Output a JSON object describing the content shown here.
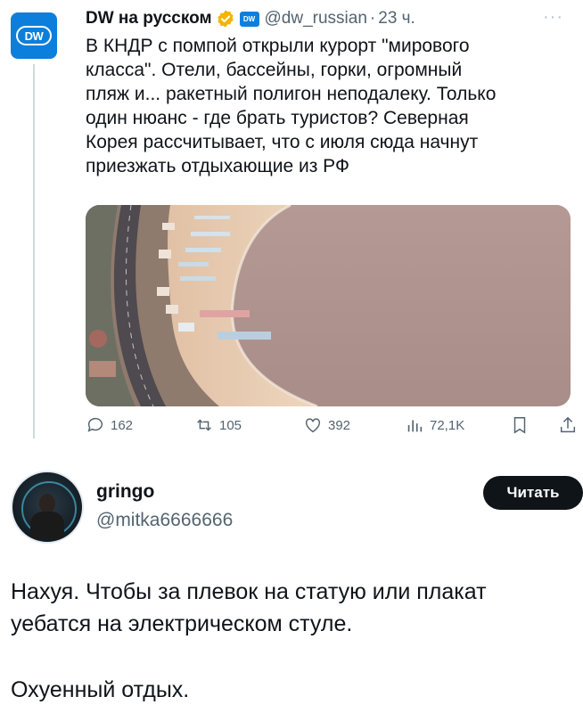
{
  "quoted_tweet": {
    "author_name": "DW на русском",
    "affiliate_badge_text": "DW",
    "handle": "@dw_russian",
    "separator": "·",
    "time": "23 ч.",
    "avatar_text": "DW",
    "more_icon": "more-dots-icon",
    "text_lines": [
      "В КНДР с помпой открыли курорт \"мирового",
      "класса\". Отели, бассейны, горки, огромный",
      "пляж и... ракетный полигон неподалеку. Только",
      "один нюанс - где брать туристов? Северная",
      "Корея рассчитывает, что с июля сюда начнут",
      "приезжать отдыхающие из РФ"
    ],
    "actions": {
      "replies": "162",
      "retweets": "105",
      "likes": "392",
      "views": "72,1K"
    },
    "colors": {
      "brand": "#0c7fdc",
      "verified": "#f4b400",
      "muted": "#536471"
    }
  },
  "reply": {
    "name": "gringo",
    "handle": "@mitka6666666",
    "button_label": "Читать",
    "paragraphs": [
      "Нахуя. Чтобы за плевок на статую или плакат",
      "уебатся на электрическом стуле.",
      "Охуенный отдых."
    ]
  }
}
